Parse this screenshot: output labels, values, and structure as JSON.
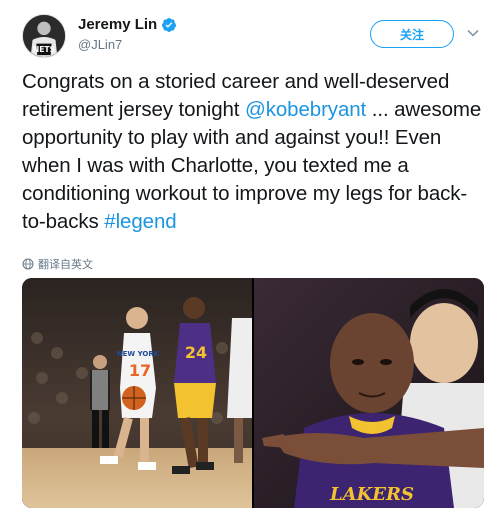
{
  "user": {
    "name": "Jeremy Lin",
    "handle": "@JLin7",
    "verified": true,
    "avatar_icon": "avatar-photo"
  },
  "actions": {
    "follow_label": "关注",
    "more_icon": "chevron-down-icon"
  },
  "tweet": {
    "text_part1": "Congrats on a storied career and well-deserved retirement jersey tonight ",
    "mention": "@kobebryant",
    "text_part2": " ... awesome opportunity to play with and against you!! Even when I was with Charlotte, you texted me a conditioning workout to improve my legs for back-to-backs ",
    "hashtag": "#legend"
  },
  "translate_label": "翻译自英文",
  "media": {
    "left_jersey_text": "NEW YORK",
    "left_jersey_number": "17",
    "right_jersey_text": "LAKERS"
  },
  "colors": {
    "accent": "#1da1f2",
    "link": "#1b95e0",
    "text": "#14171a",
    "muted": "#657786"
  }
}
